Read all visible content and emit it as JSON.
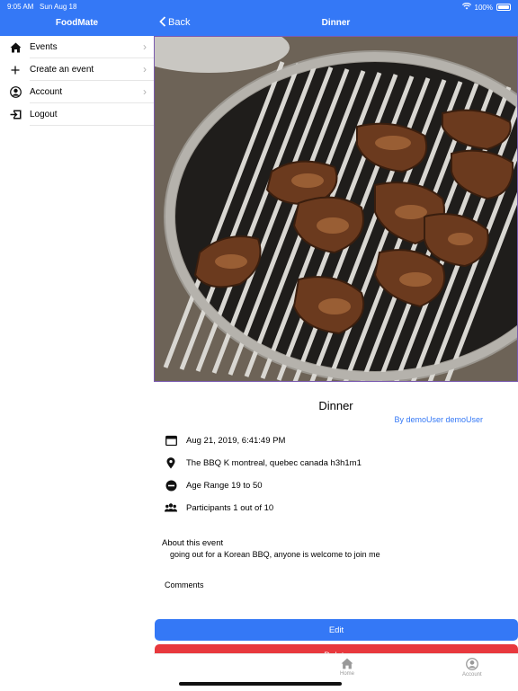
{
  "status": {
    "time": "9:05 AM",
    "date": "Sun Aug 18",
    "battery": "100%"
  },
  "sidebar": {
    "title": "FoodMate",
    "items": [
      {
        "label": "Events",
        "icon": "home-icon",
        "chevron": true
      },
      {
        "label": "Create an event",
        "icon": "plus-icon",
        "chevron": true
      },
      {
        "label": "Account",
        "icon": "account-icon",
        "chevron": true
      },
      {
        "label": "Logout",
        "icon": "logout-icon",
        "chevron": false
      }
    ]
  },
  "nav": {
    "back_label": "Back",
    "title": "Dinner"
  },
  "event": {
    "photo": "korean-bbq-grill-photo",
    "title": "Dinner",
    "author": "By demoUser demoUser",
    "date": "Aug 21, 2019, 6:41:49 PM",
    "location": "The BBQ K montreal, quebec canada h3h1m1",
    "age_range": "Age Range 19 to 50",
    "participants": "Participants 1 out of 10",
    "about_label": "About this event",
    "about_text": "going out for a Korean BBQ, anyone is welcome to join me",
    "comments_label": "Comments"
  },
  "actions": {
    "edit_label": "Edit",
    "delete_label": "Delete"
  },
  "tabbar": {
    "items": [
      {
        "label": "Home",
        "icon": "home-icon"
      },
      {
        "label": "Account",
        "icon": "account-icon"
      }
    ]
  },
  "colors": {
    "accent": "#3478f6",
    "danger": "#e8383d"
  }
}
